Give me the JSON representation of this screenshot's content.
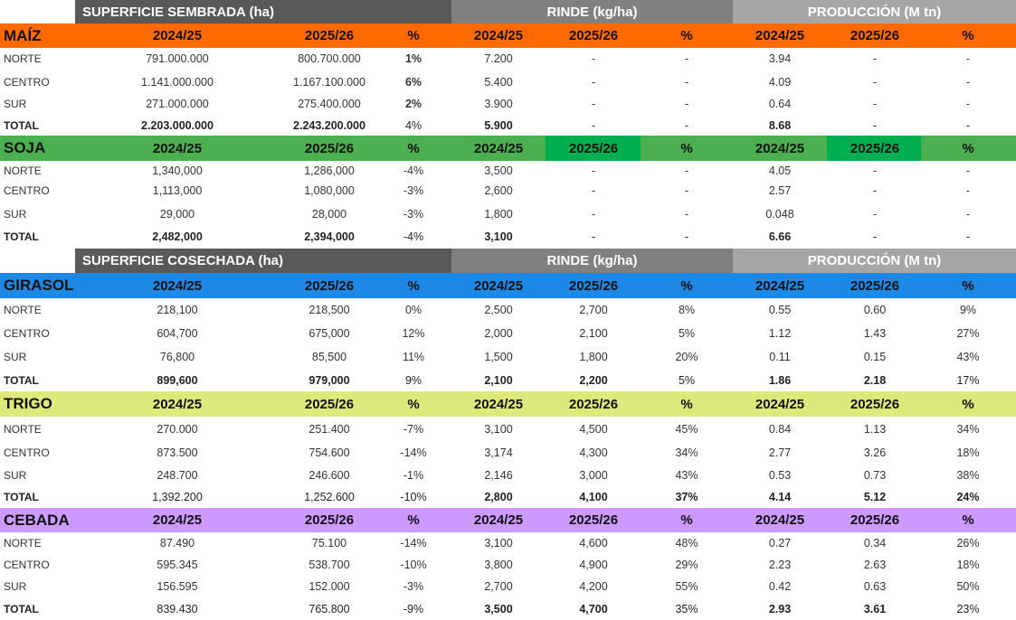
{
  "section_headers": [
    {
      "title": "SUPERFICIE SEMBRADA (ha)",
      "rinde": "RINDE (kg/ha)",
      "produccion": "PRODUCCIÓN (M tn)"
    },
    {
      "title": "SUPERFICIE COSECHADA (ha)",
      "rinde": "RINDE (kg/ha)",
      "produccion": "PRODUCCIÓN (M tn)"
    }
  ],
  "colors": {
    "maiz": "#ff6a00",
    "soja": "#4caf50",
    "soja_accent": "#00b050",
    "girasol": "#1e88e5",
    "trigo": "#dde97a",
    "cebada": "#cc99ff",
    "section_dark": "#595959",
    "section_mid": "#808080",
    "section_light": "#a6a6a6"
  },
  "crops": [
    {
      "name": "MAÍZ",
      "header": [
        "2024/25",
        "2025/26",
        "%",
        "2024/25",
        "2025/26",
        "%",
        "2024/25",
        "2025/26",
        "%"
      ],
      "rows": [
        [
          "NORTE",
          "791.000.000",
          "800.700.000",
          "1%",
          "7.200",
          "-",
          "-",
          "3.94",
          "-",
          "-"
        ],
        [
          "CENTRO",
          "1.141.000.000",
          "1.167.100.000",
          "6%",
          "5.400",
          "-",
          "-",
          "4.09",
          "-",
          "-"
        ],
        [
          "SUR",
          "271.000.000",
          "275.400.000",
          "2%",
          "3.900",
          "-",
          "-",
          "0.64",
          "-",
          "-"
        ],
        [
          "TOTAL",
          "2.203.000.000",
          "2.243.200.000",
          "4%",
          "5.900",
          "-",
          "-",
          "8.68",
          "-",
          "-"
        ]
      ]
    },
    {
      "name": "SOJA",
      "header": [
        "2024/25",
        "2025/26",
        "%",
        "2024/25",
        "2025/26",
        "%",
        "2024/25",
        "2025/26",
        "%"
      ],
      "rows": [
        [
          "NORTE",
          "1,340,000",
          "1,286,000",
          "-4%",
          "3,500",
          "-",
          "-",
          "4.05",
          "-",
          "-"
        ],
        [
          "CENTRO",
          "1,113,000",
          "1,080,000",
          "-3%",
          "2,600",
          "-",
          "-",
          "2.57",
          "-",
          "-"
        ],
        [
          "SUR",
          "29,000",
          "28,000",
          "-3%",
          "1,800",
          "-",
          "-",
          "0.048",
          "-",
          "-"
        ],
        [
          "TOTAL",
          "2,482,000",
          "2,394,000",
          "-4%",
          "3,100",
          "-",
          "-",
          "6.66",
          "-",
          "-"
        ]
      ]
    },
    {
      "name": "GIRASOL",
      "header": [
        "2024/25",
        "2025/26",
        "%",
        "2024/25",
        "2025/26",
        "%",
        "2024/25",
        "2025/26",
        "%"
      ],
      "rows": [
        [
          "NORTE",
          "218,100",
          "218,500",
          "0%",
          "2,500",
          "2,700",
          "8%",
          "0.55",
          "0.60",
          "9%"
        ],
        [
          "CENTRO",
          "604,700",
          "675,000",
          "12%",
          "2,000",
          "2,100",
          "5%",
          "1.12",
          "1.43",
          "27%"
        ],
        [
          "SUR",
          "76,800",
          "85,500",
          "11%",
          "1,500",
          "1,800",
          "20%",
          "0.11",
          "0.15",
          "43%"
        ],
        [
          "TOTAL",
          "899,600",
          "979,000",
          "9%",
          "2,100",
          "2,200",
          "5%",
          "1.86",
          "2.18",
          "17%"
        ]
      ]
    },
    {
      "name": "TRIGO",
      "header": [
        "2024/25",
        "2025/26",
        "%",
        "2024/25",
        "2025/26",
        "%",
        "2024/25",
        "2025/26",
        "%"
      ],
      "rows": [
        [
          "NORTE",
          "270.000",
          "251.400",
          "-7%",
          "3,100",
          "4,500",
          "45%",
          "0.84",
          "1.13",
          "34%"
        ],
        [
          "CENTRO",
          "873.500",
          "754.600",
          "-14%",
          "3,174",
          "4,300",
          "34%",
          "2.77",
          "3.26",
          "18%"
        ],
        [
          "SUR",
          "248.700",
          "246.600",
          "-1%",
          "2,146",
          "3,000",
          "43%",
          "0.53",
          "0.73",
          "38%"
        ],
        [
          "TOTAL",
          "1,392.200",
          "1,252.600",
          "-10%",
          "2,800",
          "4,100",
          "37%",
          "4.14",
          "5.12",
          "24%"
        ]
      ]
    },
    {
      "name": "CEBADA",
      "header": [
        "2024/25",
        "2025/26",
        "%",
        "2024/25",
        "2025/26",
        "%",
        "2024/25",
        "2025/26",
        "%"
      ],
      "rows": [
        [
          "NORTE",
          "87.490",
          "75.100",
          "-14%",
          "3,100",
          "4,600",
          "48%",
          "0.27",
          "0.34",
          "26%"
        ],
        [
          "CENTRO",
          "595.345",
          "538.700",
          "-10%",
          "3,800",
          "4,900",
          "29%",
          "2.23",
          "2.63",
          "18%"
        ],
        [
          "SUR",
          "156.595",
          "152.000",
          "-3%",
          "2,700",
          "4,200",
          "55%",
          "0.42",
          "0.63",
          "50%"
        ],
        [
          "TOTAL",
          "839.430",
          "765.800",
          "-9%",
          "3,500",
          "4,700",
          "35%",
          "2.93",
          "3.61",
          "23%"
        ]
      ]
    }
  ]
}
